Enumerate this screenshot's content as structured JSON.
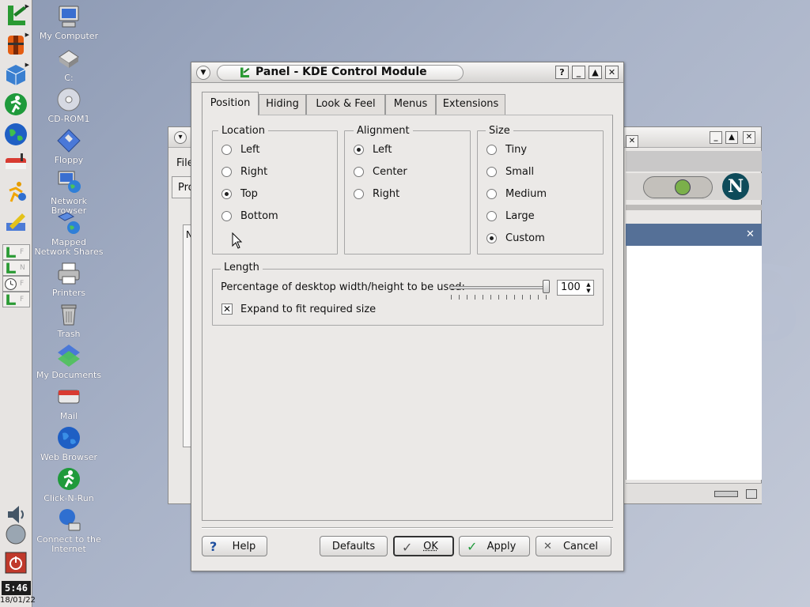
{
  "desktop": {
    "icons": [
      {
        "label": "My Computer",
        "icon": "computer-icon"
      },
      {
        "label": "C:",
        "icon": "drive-icon"
      },
      {
        "label": "CD-ROM1",
        "icon": "cdrom-icon"
      },
      {
        "label": "Floppy",
        "icon": "floppy-icon"
      },
      {
        "label": "Network Browser",
        "icon": "network-icon"
      },
      {
        "label": "Mapped Network Shares",
        "icon": "network-shares-icon"
      },
      {
        "label": "Printers",
        "icon": "printer-icon"
      },
      {
        "label": "Trash",
        "icon": "trash-icon"
      },
      {
        "label": "My Documents",
        "icon": "documents-icon"
      },
      {
        "label": "Mail",
        "icon": "mail-icon"
      },
      {
        "label": "Web Browser",
        "icon": "globe-icon"
      },
      {
        "label": "Click-N-Run",
        "icon": "click-n-run-icon"
      },
      {
        "label": "Connect to the Internet",
        "icon": "connect-icon"
      }
    ],
    "panel": {
      "clock": "5:46",
      "date": "18/01/22"
    },
    "background_window": {
      "labels": [
        "File",
        "Pro",
        "N"
      ]
    }
  },
  "dialog": {
    "title": "Panel - KDE Control Module",
    "titlebar_buttons": [
      "?",
      "_",
      "▲",
      "✕"
    ],
    "tabs": [
      {
        "label": "Position",
        "active": true
      },
      {
        "label": "Hiding"
      },
      {
        "label": "Look & Feel"
      },
      {
        "label": "Menus"
      },
      {
        "label": "Extensions"
      }
    ],
    "location": {
      "title": "Location",
      "options": [
        "Left",
        "Right",
        "Top",
        "Bottom"
      ],
      "selected": "Top"
    },
    "alignment": {
      "title": "Alignment",
      "options": [
        "Left",
        "Center",
        "Right"
      ],
      "selected": "Left"
    },
    "size": {
      "title": "Size",
      "options": [
        "Tiny",
        "Small",
        "Medium",
        "Large",
        "Custom"
      ],
      "selected": "Custom"
    },
    "length": {
      "title": "Length",
      "percentage_label": "Percentage of desktop width/height to be used:",
      "value": "100",
      "slider_fraction": 1.0,
      "expand_label": "Expand to fit required size",
      "expand_checked": true
    },
    "buttons": {
      "help": "Help",
      "defaults": "Defaults",
      "ok": "OK",
      "apply": "Apply",
      "cancel": "Cancel"
    }
  }
}
